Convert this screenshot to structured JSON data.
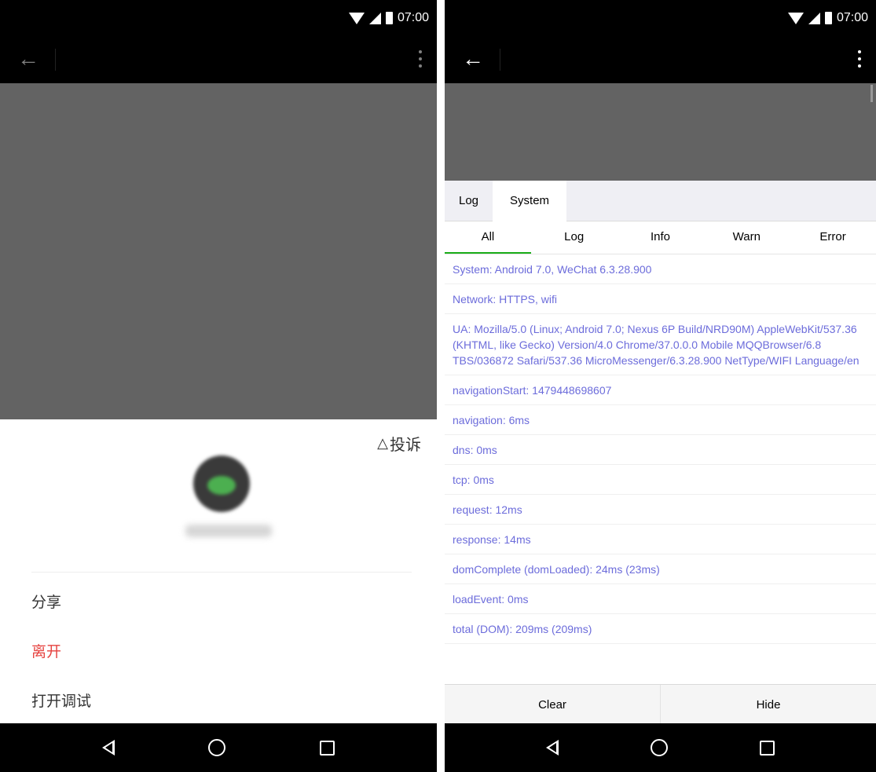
{
  "status_bar": {
    "time": "07:00"
  },
  "left": {
    "complaint_label": "投诉",
    "menu": {
      "share": "分享",
      "leave": "离开",
      "debug": "打开调试"
    }
  },
  "right": {
    "tabs": [
      "Log",
      "System"
    ],
    "active_tab": "System",
    "filters": [
      "All",
      "Log",
      "Info",
      "Warn",
      "Error"
    ],
    "active_filter": "All",
    "logs": [
      "System: Android 7.0, WeChat 6.3.28.900",
      "Network: HTTPS, wifi",
      "UA: Mozilla/5.0 (Linux; Android 7.0; Nexus 6P Build/NRD90M) AppleWebKit/537.36 (KHTML, like Gecko) Version/4.0 Chrome/37.0.0.0 Mobile MQQBrowser/6.8 TBS/036872 Safari/537.36 MicroMessenger/6.3.28.900 NetType/WIFI Language/en",
      "navigationStart: 1479448698607",
      "navigation: 6ms",
      "dns: 0ms",
      "tcp: 0ms",
      "request: 12ms",
      "response: 14ms",
      "domComplete (domLoaded): 24ms (23ms)",
      "loadEvent: 0ms",
      "total (DOM): 209ms (209ms)"
    ],
    "footer": {
      "clear": "Clear",
      "hide": "Hide"
    }
  },
  "colors": {
    "log_text": "#6c6cdb",
    "leave_text": "#e64340",
    "active_filter_underline": "#1aad19",
    "overlay": "#636363"
  }
}
